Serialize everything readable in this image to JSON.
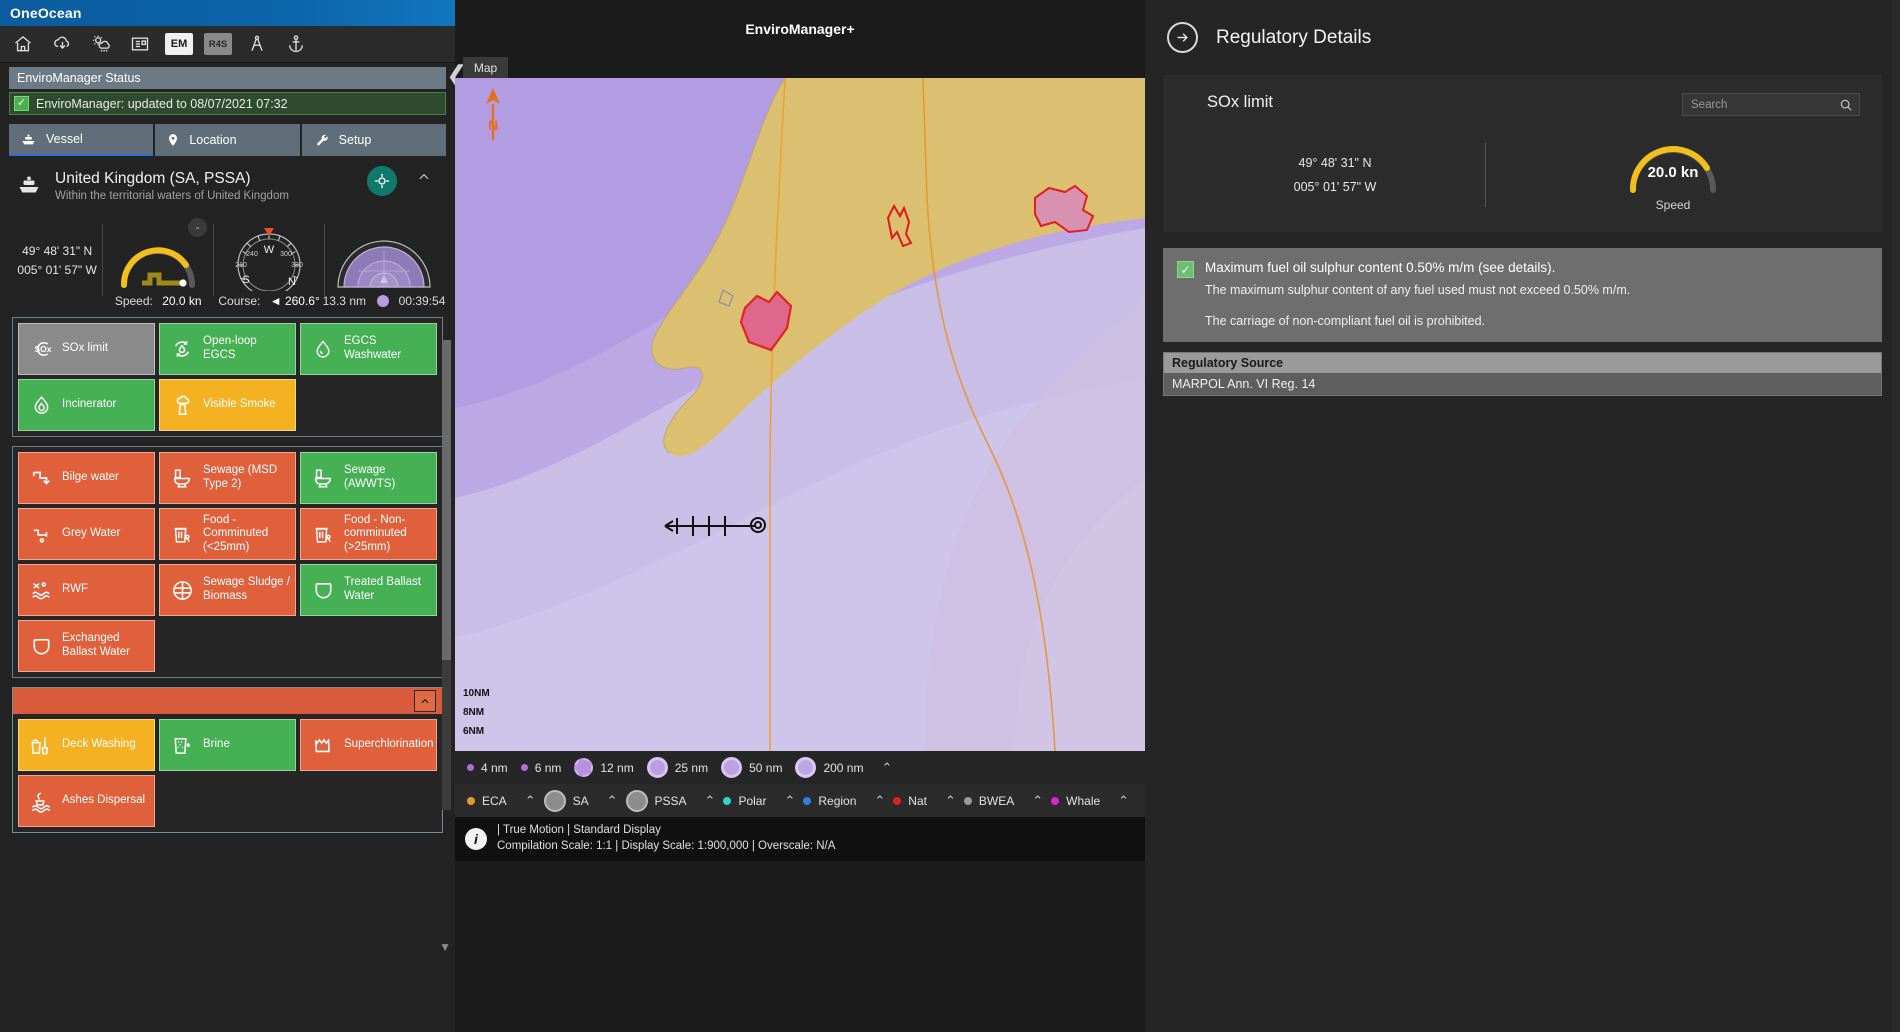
{
  "titlebar": {
    "brand": "OneOcean"
  },
  "toolbar": {
    "items": [
      {
        "name": "home-icon",
        "label": "Home"
      },
      {
        "name": "cloud-download-icon",
        "label": "Updates"
      },
      {
        "name": "weather-icon",
        "label": "Weather"
      },
      {
        "name": "news-icon",
        "label": "News"
      },
      {
        "name": "em-chip",
        "label": "EM"
      },
      {
        "name": "r4s-chip",
        "label": "R4S"
      },
      {
        "name": "dividers-icon",
        "label": "Passage Plan"
      },
      {
        "name": "anchor-icon",
        "label": "Anchor"
      }
    ]
  },
  "status": {
    "header": "EnviroManager Status",
    "message": "EnviroManager: updated to 08/07/2021 07:32"
  },
  "tabs": [
    {
      "label": "Vessel",
      "icon": "ship-icon",
      "active": true
    },
    {
      "label": "Location",
      "icon": "map-pin-icon",
      "active": false
    },
    {
      "label": "Setup",
      "icon": "wrench-icon",
      "active": false
    }
  ],
  "location": {
    "title": "United Kingdom (SA, PSSA)",
    "subtitle": "Within the territorial waters of United Kingdom"
  },
  "instruments": {
    "latitude": "49° 48' 31\" N",
    "longitude": "005° 01' 57\" W",
    "speed_label": "Speed:",
    "speed_value": "20.0 kn",
    "course_label": "Course:",
    "course_value": "260.6°",
    "compass_ticks": [
      "210",
      "240",
      "W",
      "300",
      "330",
      "S",
      "N"
    ],
    "range_value": "13.3 nm",
    "range_time": "00:39:54",
    "minus_badge": "-"
  },
  "tile_groups": [
    {
      "name": "air-emissions",
      "rows": [
        [
          {
            "label": "SOx limit",
            "color": "grey",
            "icon": "sox-cloud-icon"
          },
          {
            "label": "Open-loop EGCS",
            "color": "green",
            "icon": "recycle-drop-icon"
          },
          {
            "label": "EGCS Washwater",
            "color": "green",
            "icon": "droplet-icon"
          }
        ],
        [
          {
            "label": "Incinerator",
            "color": "green",
            "icon": "flame-icon"
          },
          {
            "label": "Visible Smoke",
            "color": "amber",
            "icon": "smokestack-icon"
          },
          {
            "label": "",
            "color": "empty",
            "icon": ""
          }
        ]
      ]
    },
    {
      "name": "water-discharges",
      "rows": [
        [
          {
            "label": "Bilge water",
            "color": "red",
            "icon": "bilge-pipe-icon"
          },
          {
            "label": "Sewage (MSD Type 2)",
            "color": "red",
            "icon": "toilet-icon"
          },
          {
            "label": "Sewage (AWWTS)",
            "color": "green",
            "icon": "toilet-icon"
          }
        ],
        [
          {
            "label": "Grey Water",
            "color": "red",
            "icon": "faucet-icon"
          },
          {
            "label": "Food - Comminuted (<25mm)",
            "color": "red",
            "icon": "food-waste-icon"
          },
          {
            "label": "Food - Non-comminuted (>25mm)",
            "color": "red",
            "icon": "food-waste-icon"
          }
        ],
        [
          {
            "label": "RWF",
            "color": "red",
            "icon": "waves-fish-icon"
          },
          {
            "label": "Sewage Sludge / Biomass",
            "color": "red",
            "icon": "sludge-icon"
          },
          {
            "label": "Treated Ballast Water",
            "color": "green",
            "icon": "ballast-icon"
          }
        ],
        [
          {
            "label": "Exchanged Ballast Water",
            "color": "red",
            "icon": "ballast-icon"
          },
          {
            "label": "",
            "color": "empty",
            "icon": ""
          },
          {
            "label": "",
            "color": "empty",
            "icon": ""
          }
        ]
      ]
    },
    {
      "name": "other-discharges",
      "has_header": true,
      "rows": [
        [
          {
            "label": "Deck Washing",
            "color": "amber",
            "icon": "deck-wash-icon"
          },
          {
            "label": "Brine",
            "color": "green",
            "icon": "brine-glass-icon"
          },
          {
            "label": "Superchlorination",
            "color": "red",
            "icon": "chlorine-basin-icon"
          }
        ],
        [
          {
            "label": "Ashes Dispersal",
            "color": "red",
            "icon": "ashes-icon"
          },
          {
            "label": "",
            "color": "empty",
            "icon": ""
          },
          {
            "label": "",
            "color": "empty",
            "icon": ""
          }
        ]
      ]
    }
  ],
  "map": {
    "app_title": "EnviroManager+",
    "tab_label": "Map",
    "scale_labels": [
      "10NM",
      "8NM",
      "6NM"
    ],
    "zoom_legend": [
      {
        "label": "4 nm",
        "style": "dot-small",
        "color": "#b06fd6"
      },
      {
        "label": "6 nm",
        "style": "dot-small",
        "color": "#b06fd6"
      },
      {
        "label": "12 nm",
        "style": "ring-dashed",
        "color": "#b98fe0"
      },
      {
        "label": "25 nm",
        "style": "ring",
        "color": "#c7aee8"
      },
      {
        "label": "50 nm",
        "style": "ring",
        "color": "#cbb4e8"
      },
      {
        "label": "200 nm",
        "style": "ring",
        "color": "#d2bdea"
      }
    ],
    "area_legend": [
      {
        "label": "ECA",
        "style": "dot",
        "color": "#e09b2d"
      },
      {
        "label": "SA",
        "style": "ring-grey",
        "color": "#8d8d8d"
      },
      {
        "label": "PSSA",
        "style": "ring-grey",
        "color": "#8d8d8d"
      },
      {
        "label": "Polar",
        "style": "dot",
        "color": "#2fd6c8"
      },
      {
        "label": "Region",
        "style": "dot",
        "color": "#2f7fe0"
      },
      {
        "label": "Nat",
        "style": "dot",
        "color": "#e02020"
      },
      {
        "label": "BWEA",
        "style": "dot",
        "color": "#9a9a9a"
      },
      {
        "label": "Whale",
        "style": "dot",
        "color": "#e020d0"
      }
    ],
    "info_line1": "| True Motion | Standard Display",
    "info_line2": "Compilation Scale: 1:1  | Display Scale: 1:900,000  | Overscale: N/A"
  },
  "right_panel": {
    "title": "Regulatory Details",
    "card_title": "SOx limit",
    "search_placeholder": "Search",
    "search_value": "",
    "latitude": "49° 48' 31\" N",
    "longitude": "005° 01' 57\" W",
    "speed_value": "20.0 kn",
    "speed_label": "Speed",
    "regulation": {
      "heading": "Maximum fuel oil sulphur content 0.50% m/m (see details).",
      "detail1": "The maximum sulphur content of any fuel used must not exceed 0.50% m/m.",
      "detail2": "The carriage of non-compliant fuel oil is prohibited."
    },
    "source_table": {
      "header": "Regulatory Source",
      "rows": [
        "MARPOL Ann. VI Reg. 14"
      ]
    }
  },
  "colors": {
    "brand_blue": "#0c63a8",
    "green": "#46b054",
    "amber": "#f4b223",
    "red": "#e0603c",
    "grey": "#8a8a8a",
    "teal_gps": "#0f7a6c"
  }
}
